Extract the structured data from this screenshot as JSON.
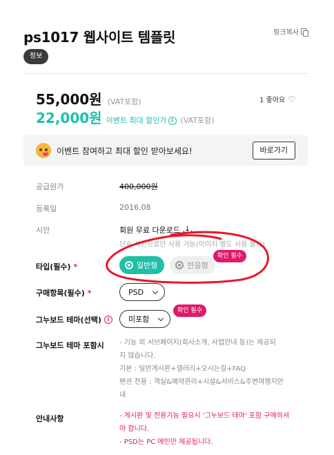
{
  "product": {
    "title": "ps1017 웹사이트 템플릿",
    "copy_link": "링크복사",
    "badge": "정보"
  },
  "price": {
    "amount": "55,000원",
    "vat": "(VAT포함)",
    "likes": "1 좋아요",
    "event_amount": "22,000원",
    "event_label": "이벤트 최대 할인가",
    "event_vat": "(VAT포함)"
  },
  "event": {
    "text": "이벤트 참여하고 최대 할인 받아보세요!",
    "button": "바로가기"
  },
  "details": {
    "supply_label": "공급원가",
    "supply_value": "400,000원",
    "date_label": "등록일",
    "date_value": "2016.08",
    "draft_label": "시안",
    "draft_value": "회원 무료 다운로드",
    "draft_note": "단순 시안으로만 사용 가능(이미지 별도 사용 불가)"
  },
  "options": {
    "type_label": "타입(필수)",
    "type_options": [
      "일반형",
      "반응형"
    ],
    "type_selected": "일반형",
    "confirm_tag": "확인 필수",
    "purchase_label": "구매항목(필수)",
    "purchase_value": "PSD",
    "gnuboard_label": "그누보드 테마(선택)",
    "gnuboard_value": "미포함",
    "gnuboard_tag": "확인 필수",
    "required_mark": "*"
  },
  "includes": {
    "label": "그누보드 테마 포함시",
    "lines": [
      "- 기능 외 서브페이지(회사소개, 사업안내 등)는 제공되",
      "지 않습니다.",
      "기본 : 일반게시판+갤러리+오시는길+FAQ",
      "펜션 전용 : 객실&예약관리+시설&서비스&주변여행지안",
      "내"
    ]
  },
  "notice": {
    "label": "안내사항",
    "lines": [
      "- 게시판 및 전용기능 필요시 '그누보드 테마' 포함 구매하셔",
      "야 합니다.",
      "- PSD는 PC 메인만 제공됩니다."
    ]
  },
  "colors": {
    "accent": "#1fbfa8",
    "pink": "#e0196b",
    "annotation": "#e8162b"
  }
}
